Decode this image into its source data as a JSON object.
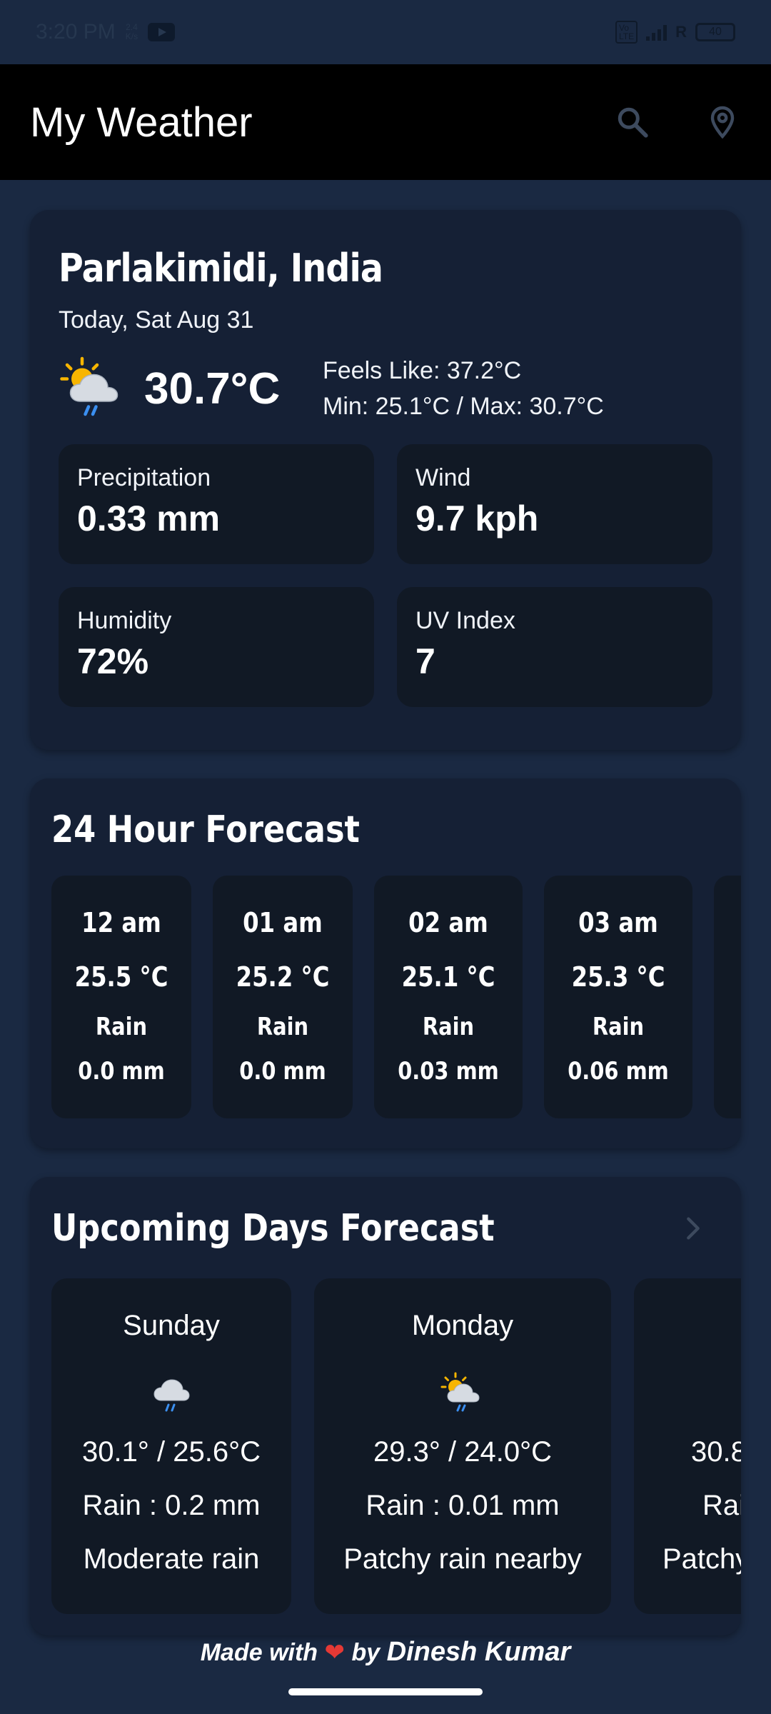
{
  "status_bar": {
    "time": "3:20 PM",
    "speed_value": "2.4",
    "speed_unit": "K/s",
    "network": "R",
    "battery": "40"
  },
  "app_bar": {
    "title": "My Weather",
    "search_icon": "search-icon",
    "location_icon": "location-pin-icon"
  },
  "current": {
    "location": "Parlakimidi, India",
    "date": "Today, Sat Aug 31",
    "icon": "sun-cloud-rain-icon",
    "temperature": "30.7°C",
    "feels_like": "Feels Like: 37.2°C",
    "min_max": "Min: 25.1°C / Max: 30.7°C",
    "stats": [
      {
        "label": "Precipitation",
        "value": "0.33 mm"
      },
      {
        "label": "Wind",
        "value": "9.7 kph"
      },
      {
        "label": "Humidity",
        "value": "72%"
      },
      {
        "label": "UV Index",
        "value": "7"
      }
    ]
  },
  "hourly": {
    "title": "24 Hour Forecast",
    "items": [
      {
        "time": "12 am",
        "temp": "25.5 °C",
        "condition": "Rain",
        "rain": "0.0 mm"
      },
      {
        "time": "01 am",
        "temp": "25.2 °C",
        "condition": "Rain",
        "rain": "0.0 mm"
      },
      {
        "time": "02 am",
        "temp": "25.1 °C",
        "condition": "Rain",
        "rain": "0.03 mm"
      },
      {
        "time": "03 am",
        "temp": "25.3 °C",
        "condition": "Rain",
        "rain": "0.06 mm"
      }
    ]
  },
  "daily": {
    "title": "Upcoming Days Forecast",
    "items": [
      {
        "day": "Sunday",
        "icon": "cloud-rain-icon",
        "temp": "30.1° / 25.6°C",
        "rain": "Rain : 0.2 mm",
        "condition": "Moderate rain"
      },
      {
        "day": "Monday",
        "icon": "sun-cloud-rain-icon",
        "temp": "29.3° / 24.0°C",
        "rain": "Rain : 0.01 mm",
        "condition": "Patchy rain nearby"
      },
      {
        "day": "T",
        "icon": "",
        "temp": "30.8",
        "rain": "Rain",
        "condition": "Patchy"
      }
    ]
  },
  "footer": {
    "made_with": "Made with",
    "by": "by",
    "author": "Dinesh Kumar"
  },
  "colors": {
    "background": "#1a2942",
    "card": "#152035",
    "tile": "#111925",
    "app_bar": "#000000",
    "heart": "#e53935"
  }
}
